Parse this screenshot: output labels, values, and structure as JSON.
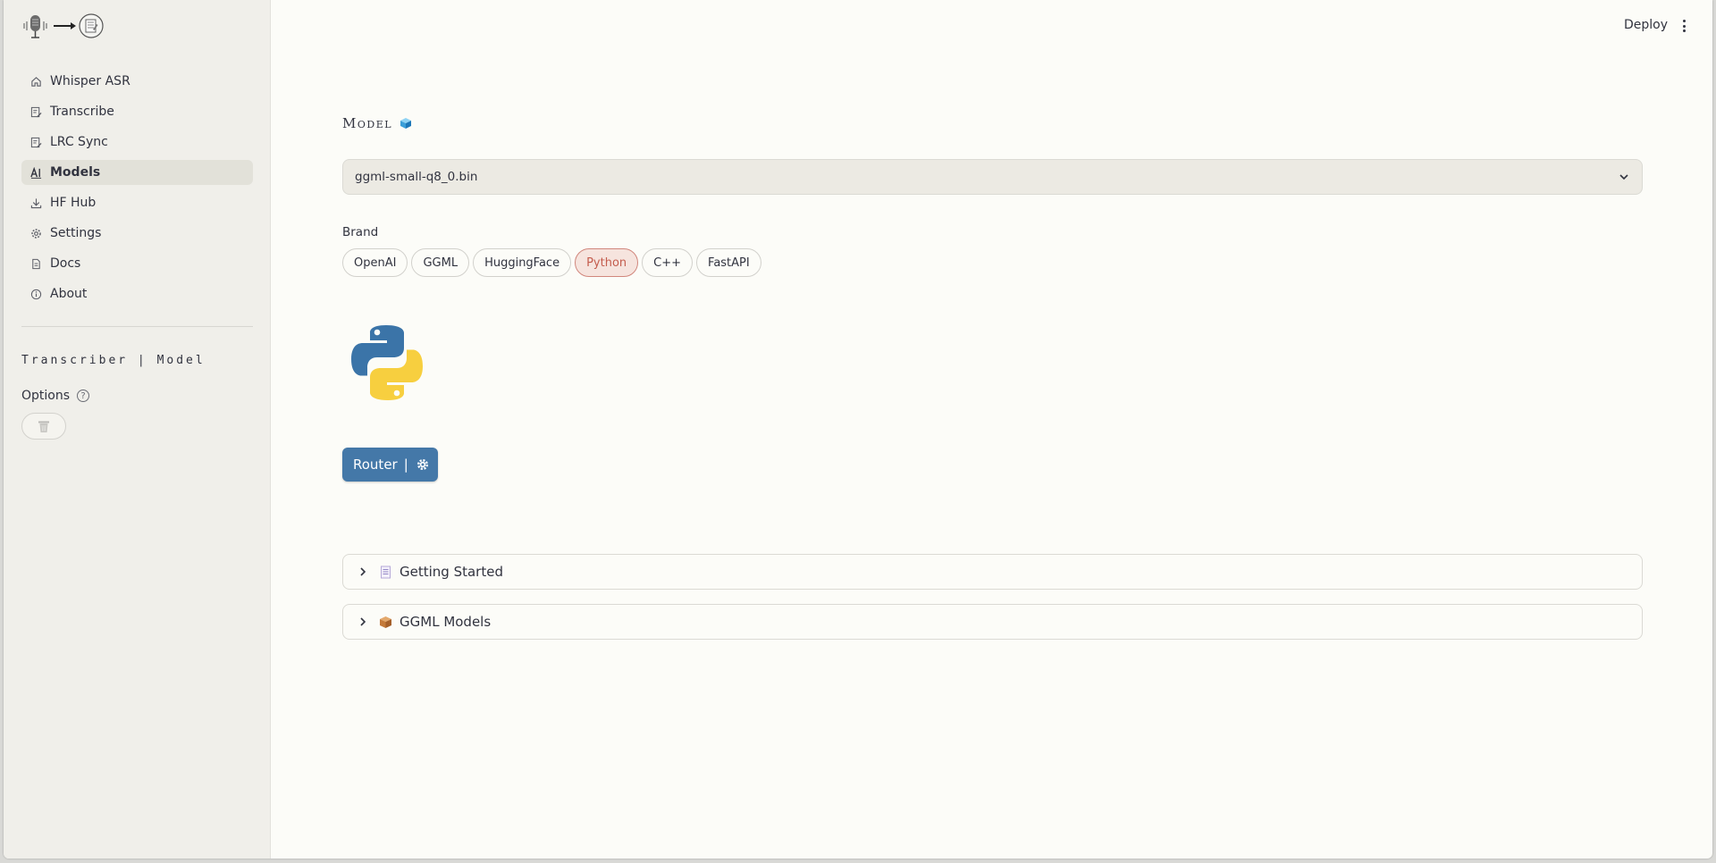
{
  "sidebar": {
    "items": [
      {
        "label": "Whisper ASR",
        "icon": "home-icon"
      },
      {
        "label": "Transcribe",
        "icon": "edit-note-icon"
      },
      {
        "label": "LRC Sync",
        "icon": "edit-note-icon"
      },
      {
        "label": "Models",
        "icon": "ai-icon",
        "active": true
      },
      {
        "label": "HF Hub",
        "icon": "download-icon"
      },
      {
        "label": "Settings",
        "icon": "gear-icon"
      },
      {
        "label": "Docs",
        "icon": "document-icon"
      },
      {
        "label": "About",
        "icon": "info-icon"
      }
    ],
    "section_title": "Transcriber | Model",
    "options_label": "Options",
    "help_glyph": "?"
  },
  "header": {
    "deploy_label": "Deploy"
  },
  "main": {
    "model_heading": "Model",
    "model_select_value": "ggml-small-q8_0.bin",
    "brand_label": "Brand",
    "brands": [
      "OpenAI",
      "GGML",
      "HuggingFace",
      "Python",
      "C++",
      "FastAPI"
    ],
    "selected_brand": "Python",
    "router_button_label": "Router",
    "router_separator": "|",
    "expanders": [
      {
        "label": "Getting Started",
        "icon": "document-icon"
      },
      {
        "label": "GGML Models",
        "icon": "package-icon"
      }
    ]
  },
  "colors": {
    "accent": "#4478a8",
    "selected_pill_border": "#d1867c",
    "selected_pill_text": "#c45d4e",
    "sidebar_bg": "#f0efea"
  }
}
